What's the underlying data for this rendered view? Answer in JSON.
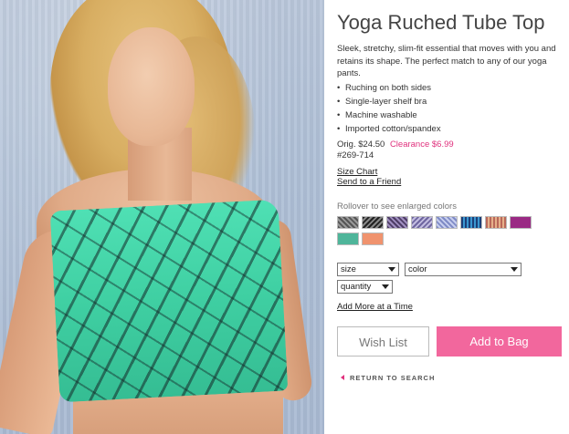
{
  "product": {
    "title": "Yoga Ruched Tube Top",
    "description": "Sleek, stretchy, slim-fit essential that moves with you and retains its shape. The perfect match to any of our yoga pants.",
    "features": [
      "Ruching on both sides",
      "Single-layer shelf bra",
      "Machine washable",
      "Imported cotton/spandex"
    ],
    "orig_price": "Orig. $24.50",
    "clearance_price": "Clearance $6.99",
    "sku": "#269-714"
  },
  "links": {
    "size_chart": "Size Chart",
    "send_to_friend": "Send to a Friend",
    "add_more": "Add More at a Time"
  },
  "colors": {
    "rollover_text": "Rollover to see enlarged colors",
    "swatches": [
      {
        "name": "print-grey",
        "color": "#6a6a72"
      },
      {
        "name": "print-black",
        "color": "#3a3a3a"
      },
      {
        "name": "print-purple",
        "color": "#6e5a84"
      },
      {
        "name": "print-lilac",
        "color": "#8d86b6"
      },
      {
        "name": "print-periwinkle",
        "color": "#9aa5d8"
      },
      {
        "name": "stripe-blue",
        "color": "#2e6ea8"
      },
      {
        "name": "stripe-multi",
        "color": "#c98b73"
      },
      {
        "name": "magenta",
        "color": "#9a2a84"
      },
      {
        "name": "teal",
        "color": "#4fb59a"
      },
      {
        "name": "coral",
        "color": "#f0936e"
      }
    ]
  },
  "selects": {
    "size": "size",
    "color": "color",
    "quantity": "quantity"
  },
  "buttons": {
    "wish_list": "Wish List",
    "add_to_bag": "Add to Bag",
    "return_to_search": "RETURN TO SEARCH"
  }
}
